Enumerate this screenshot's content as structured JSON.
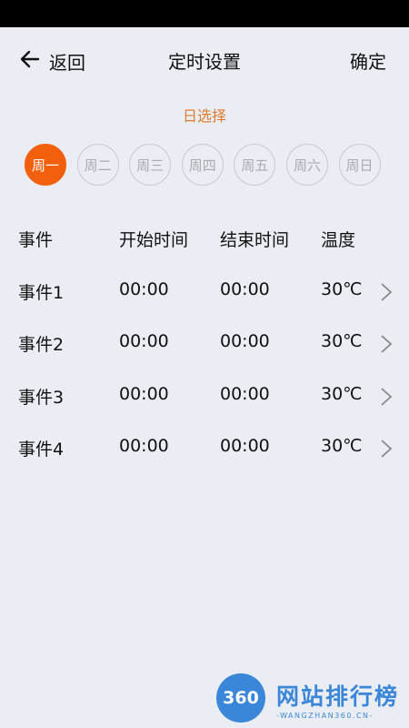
{
  "header": {
    "back_label": "返回",
    "title": "定时设置",
    "confirm_label": "确定"
  },
  "day_section": {
    "label": "日选择",
    "days": [
      "周一",
      "周二",
      "周三",
      "周四",
      "周五",
      "周六",
      "周日"
    ],
    "selected": "周一",
    "accent_color": "#f2600e"
  },
  "table": {
    "headers": [
      "事件",
      "开始时间",
      "结束时间",
      "温度"
    ],
    "rows": [
      {
        "event": "事件1",
        "start": "00:00",
        "end": "00:00",
        "temp": "30℃"
      },
      {
        "event": "事件2",
        "start": "00:00",
        "end": "00:00",
        "temp": "30℃"
      },
      {
        "event": "事件3",
        "start": "00:00",
        "end": "00:00",
        "temp": "30℃"
      },
      {
        "event": "事件4",
        "start": "00:00",
        "end": "00:00",
        "temp": "30℃"
      }
    ]
  },
  "watermark": {
    "badge": "360",
    "text": "网站排行榜",
    "sub": "-WANGZHAN360.CN-"
  }
}
